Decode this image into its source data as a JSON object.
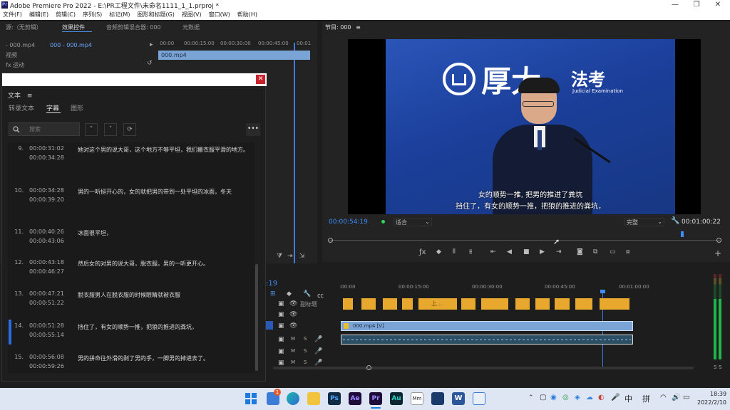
{
  "window": {
    "title": "Adobe Premiere Pro 2022 - E:\\PR工程文件\\未命名1111_1_1.prproj *",
    "app_icon": "Pr"
  },
  "menu": [
    "文件(F)",
    "编辑(E)",
    "剪辑(C)",
    "序列(S)",
    "标记(M)",
    "图形和标题(G)",
    "视图(V)",
    "窗口(W)",
    "帮助(H)"
  ],
  "source_panel": {
    "tabs": [
      "源:（无剪辑）",
      "效果控件",
      "音频剪辑混合器: 000",
      "元数据"
    ],
    "active_tab": "效果控件",
    "crumb_left": "- 000.mp4",
    "crumb_right": "000 - 000.mp4",
    "ruler": [
      "00:00",
      "00:00:15:00",
      "00:00:30:00",
      "00:00:45:00",
      "00:01"
    ],
    "clip_label": "000.mp4",
    "video_label": "视频",
    "motion_label": "运动"
  },
  "captions_panel": {
    "title": "文本",
    "tabs": [
      "转录文本",
      "字幕",
      "图形"
    ],
    "active_tab": "字幕",
    "search_placeholder": "搜索",
    "items": [
      {
        "num": "9.",
        "start": "00:00:31:02",
        "end": "00:00:34:28",
        "text": "她对这个男的说大哥，这个地方不够平坦，我们搬衣服平滑的地方。"
      },
      {
        "num": "10.",
        "start": "00:00:34:28",
        "end": "00:00:39:20",
        "text": "男的一听挺开心的，女的就把男的带到一处平坦的冰面，冬天"
      },
      {
        "num": "11.",
        "start": "00:00:40:26",
        "end": "00:00:43:06",
        "text": "冰面很平坦，"
      },
      {
        "num": "12.",
        "start": "00:00:43:18",
        "end": "00:00:46:27",
        "text": "然后女的对男的说大哥，脱衣服。男的一听更开心。"
      },
      {
        "num": "13.",
        "start": "00:00:47:21",
        "end": "00:00:51:22",
        "text": "脱衣服男人在脱衣服的时候眼睛就被衣服"
      },
      {
        "num": "14.",
        "start": "00:00:51:28",
        "end": "00:00:55:14",
        "text": "挡住了，有女的顺势一推，把狼的推进的粪坑，"
      },
      {
        "num": "15.",
        "start": "00:00:56:08",
        "end": "00:00:59:26",
        "text": "男的拼命往外滑的剥了男的手，一脚男的掉进去了。"
      }
    ],
    "selected_index": 5
  },
  "program": {
    "title": "节目: 000",
    "timecode": "00:00:54:19",
    "fit": "适合",
    "quality": "完整",
    "duration": "00:01:00:22",
    "overlay_logo_text": "厚大",
    "overlay_brand": "法考",
    "overlay_sub": "Judicial Examination",
    "subtitle_line1": "女的顺势一推, 把男的推进了粪坑",
    "subtitle_line2": "挡住了，有女的顺势一推，把狼的推进的粪坑，"
  },
  "timeline": {
    "timecode": ":19",
    "ruler": [
      ":00:00",
      "00:00:15:00",
      "00:00:30:00",
      "00:00:45:00",
      "00:01:00:00"
    ],
    "subtitle_track": "副标题",
    "video_clip": "000.mp4 [V]",
    "subtitle_clip_text": "上..."
  },
  "audio_meter": {
    "labels": [
      "S",
      "S"
    ]
  },
  "taskbar": {
    "time": "18:39",
    "date": "2022/2/10",
    "ime1": "中",
    "ime2": "拼",
    "badge": "1",
    "app_badge_text": "Mm",
    "ps": "Ps",
    "ae": "Ae",
    "pr": "Pr",
    "au": "Au"
  }
}
